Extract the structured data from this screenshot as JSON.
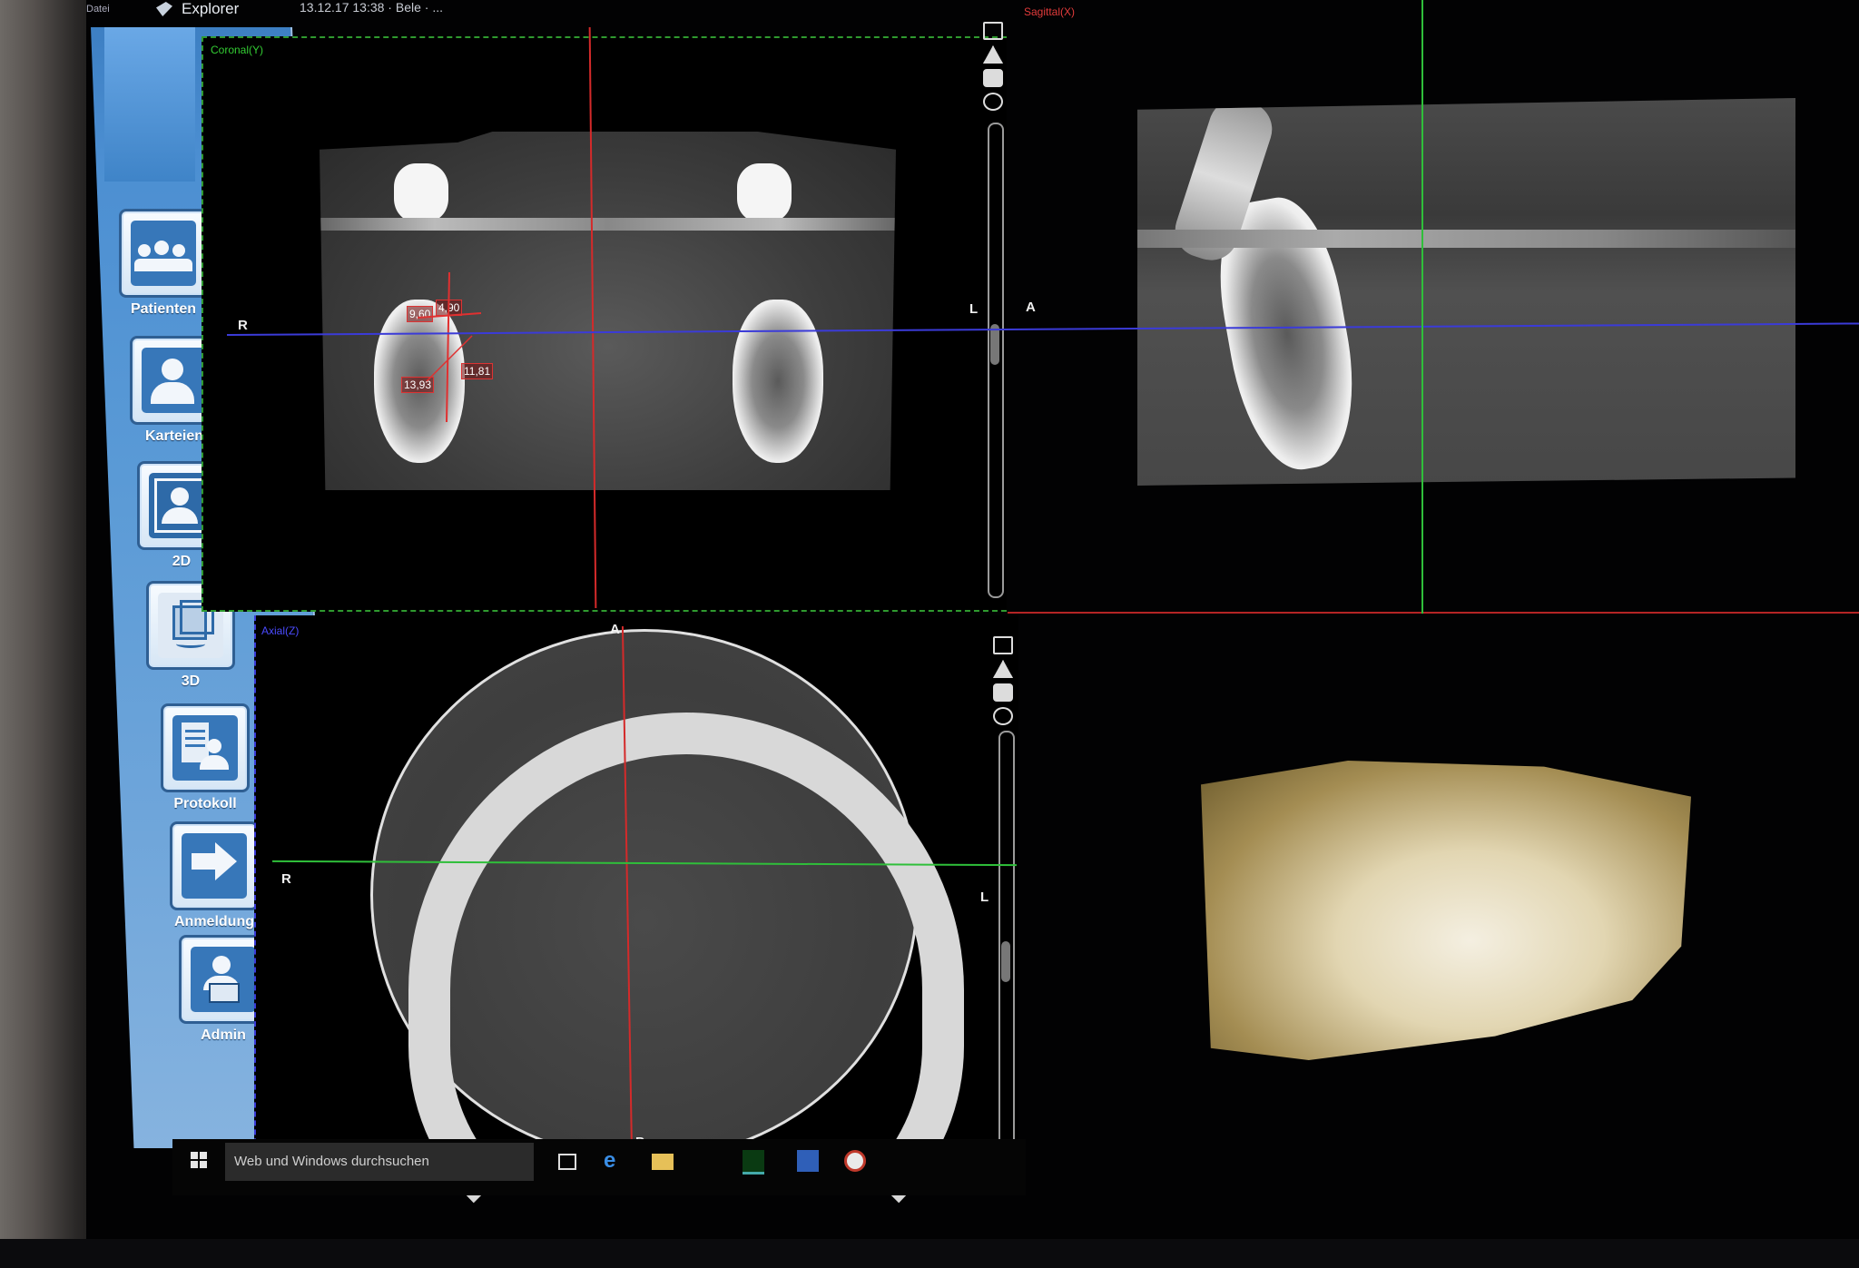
{
  "titlebar": {
    "menu": "Datei",
    "app_name": "Explorer",
    "date_text": "13.12.17 13:38 · Bele · ..."
  },
  "sidebar": {
    "items": [
      {
        "label": "Patienten",
        "icon": "patients-icon"
      },
      {
        "label": "Karteien",
        "icon": "patient-record-icon"
      },
      {
        "label": "2D",
        "icon": "image-2d-icon"
      },
      {
        "label": "3D",
        "icon": "cube-3d-icon"
      },
      {
        "label": "Protokoll",
        "icon": "protocol-icon"
      },
      {
        "label": "Anmeldung",
        "icon": "login-arrow-icon"
      },
      {
        "label": "Admin",
        "icon": "admin-icon"
      }
    ]
  },
  "viewports": {
    "coronal": {
      "label": "Coronal(Y)",
      "left_orient": "R",
      "right_orient": "L",
      "measurements": [
        "9,60",
        "4,90",
        "13,93",
        "11,81"
      ]
    },
    "sagittal": {
      "label": "Sagittal(X)",
      "left_orient": "A"
    },
    "axial": {
      "label": "Axial(Z)",
      "top_orient": "A",
      "bottom_orient": "P",
      "left_orient": "R",
      "right_orient": "L"
    },
    "render3d": {}
  },
  "taskbar": {
    "search_placeholder": "Web und Windows durchsuchen",
    "icons": [
      "task-view-icon",
      "edge-browser-icon",
      "file-explorer-icon",
      "galileos-icon",
      "word-icon",
      "app-r-icon"
    ]
  },
  "colors": {
    "sidebar_blue": "#4c8fd2",
    "crosshair_red": "#d42a2a",
    "crosshair_green": "#2fbf3a",
    "crosshair_blue": "#3b3bd8"
  }
}
